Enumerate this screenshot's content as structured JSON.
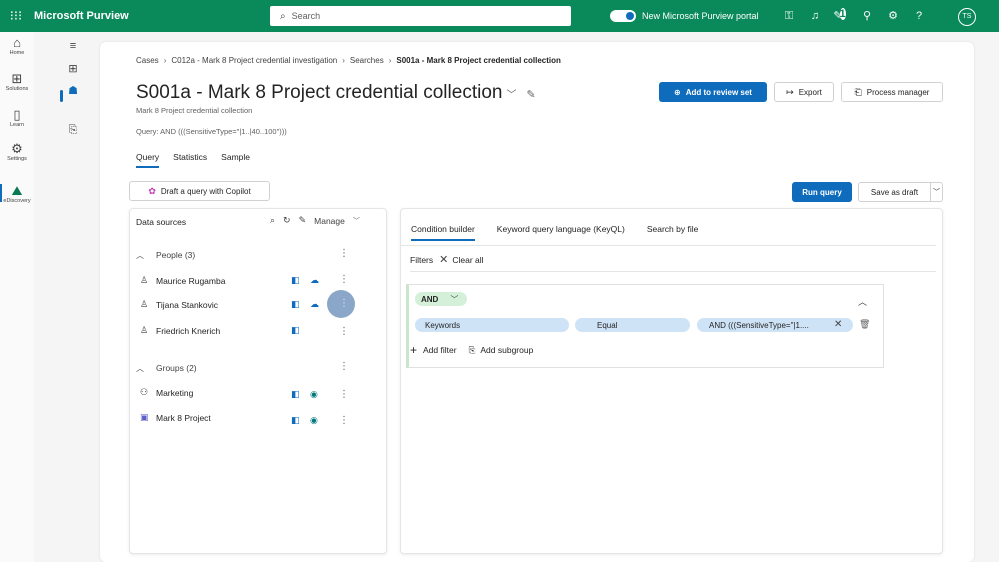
{
  "topbar": {
    "app_title": "Microsoft Purview",
    "search_placeholder": "Search",
    "portal_toggle_label": "New Microsoft Purview portal",
    "notification_count": "1",
    "user_initials": "TS"
  },
  "rail": {
    "items": [
      {
        "label": "Home",
        "icon": "home-icon"
      },
      {
        "label": "Solutions",
        "icon": "solutions-icon"
      },
      {
        "label": "Learn",
        "icon": "learn-icon"
      },
      {
        "label": "Settings",
        "icon": "settings-icon"
      },
      {
        "label": "eDiscovery",
        "icon": "ediscovery-icon"
      }
    ]
  },
  "breadcrumb": {
    "items": [
      "Cases",
      "C012a - Mark 8 Project credential investigation",
      "Searches",
      "S001a - Mark 8 Project credential collection"
    ]
  },
  "header": {
    "title": "S001a - Mark 8 Project credential collection",
    "subtitle": "Mark 8 Project credential collection",
    "query": "Query: AND (((SensitiveType=\"|1..|40..100\")))"
  },
  "actions": {
    "add_to_review_set": "Add to review set",
    "export": "Export",
    "process_manager": "Process manager",
    "copilot": "Draft a query with Copilot",
    "run_query": "Run query",
    "save_as_draft": "Save as draft"
  },
  "tabs": [
    "Query",
    "Statistics",
    "Sample"
  ],
  "data_sources": {
    "title": "Data sources",
    "manage_label": "Manage",
    "people_group": "People (3)",
    "people": [
      {
        "name": "Maurice Rugamba"
      },
      {
        "name": "Tijana Stankovic"
      },
      {
        "name": "Friedrich Knerich"
      }
    ],
    "groups_group": "Groups (2)",
    "groups": [
      {
        "name": "Marketing"
      },
      {
        "name": "Mark 8 Project"
      }
    ]
  },
  "condition_builder": {
    "tabs": [
      "Condition builder",
      "Keyword query language (KeyQL)",
      "Search by file"
    ],
    "filters_label": "Filters",
    "clear_all": "Clear all",
    "operator": "AND",
    "condition": {
      "field": "Keywords",
      "operator": "Equal",
      "value": "AND (((SensitiveType=\"|1...."
    },
    "add_filter": "Add filter",
    "add_subgroup": "Add subgroup"
  }
}
